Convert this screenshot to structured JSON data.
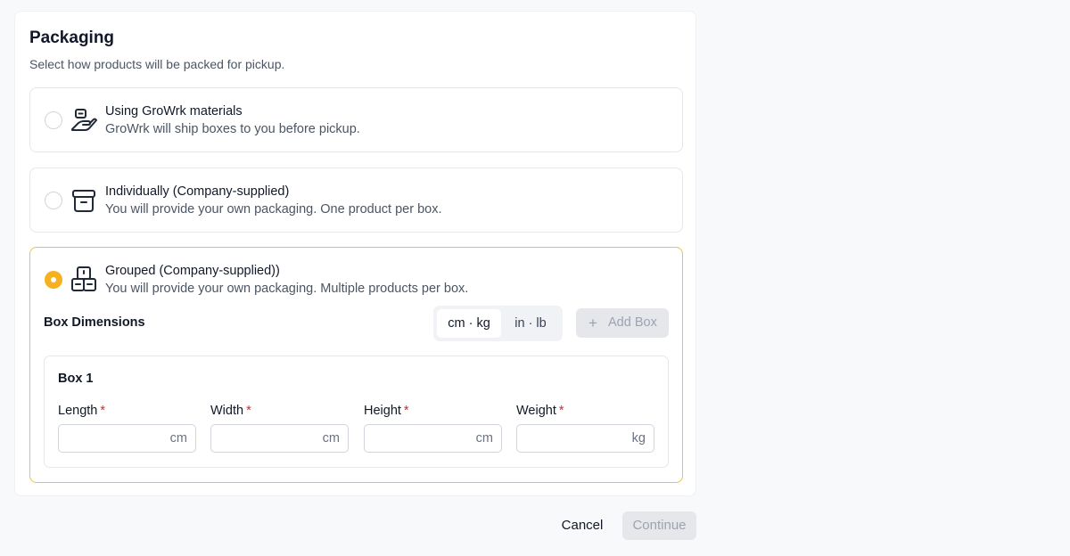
{
  "section": {
    "title": "Packaging",
    "subtitle": "Select how products will be packed for pickup."
  },
  "options": [
    {
      "title": "Using GroWrk materials",
      "description": "GroWrk will ship boxes to you before pickup.",
      "icon": "hand-holding-box-icon",
      "selected": false
    },
    {
      "title": "Individually (Company-supplied)",
      "description": "You will provide your own packaging. One product per box.",
      "icon": "archive-box-icon",
      "selected": false
    },
    {
      "title": "Grouped (Company-supplied))",
      "description": "You will provide your own packaging. Multiple products per box.",
      "icon": "stacked-boxes-icon",
      "selected": true
    }
  ],
  "box_dimensions": {
    "label": "Box Dimensions",
    "units": [
      {
        "label": "cm · kg",
        "active": true
      },
      {
        "label": "in · lb",
        "active": false
      }
    ],
    "add_box_label": "Add Box",
    "boxes": [
      {
        "title": "Box 1",
        "fields": [
          {
            "label": "Length",
            "required_mark": "*",
            "unit": "cm",
            "value": ""
          },
          {
            "label": "Width",
            "required_mark": "*",
            "unit": "cm",
            "value": ""
          },
          {
            "label": "Height",
            "required_mark": "*",
            "unit": "cm",
            "value": ""
          },
          {
            "label": "Weight",
            "required_mark": "*",
            "unit": "kg",
            "value": ""
          }
        ]
      }
    ]
  },
  "footer": {
    "cancel_label": "Cancel",
    "continue_label": "Continue"
  },
  "colors": {
    "accent": "#f6b11e",
    "selected_border": "#f0c040",
    "required": "#dc2626",
    "disabled_bg": "#e5e7eb",
    "disabled_text": "#9ca3af"
  }
}
